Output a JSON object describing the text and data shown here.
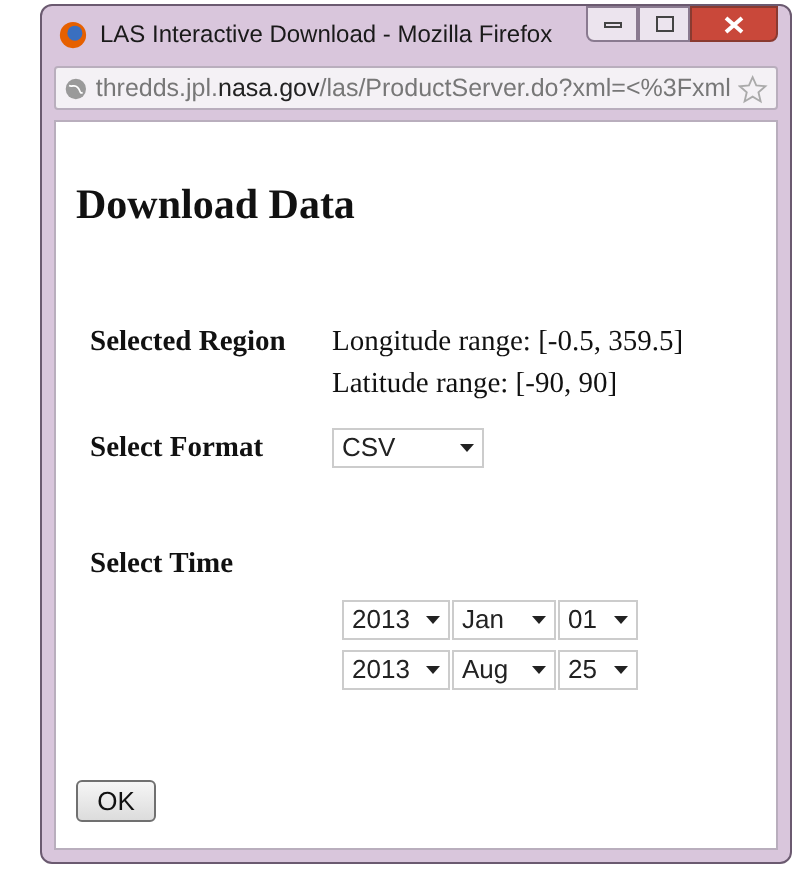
{
  "window": {
    "title": "LAS Interactive Download - Mozilla Firefox"
  },
  "address_bar": {
    "url": "thredds.jpl.**nasa.gov**/las/ProductServer.do?xml=<%3Fxml"
  },
  "heading": "Download Data",
  "region": {
    "label": "Selected Region",
    "lines": [
      "Longitude range: [-0.5, 359.5]",
      "Latitude range: [-90, 90]"
    ]
  },
  "format": {
    "label": "Select Format",
    "value": "CSV"
  },
  "time": {
    "label": "Select Time",
    "rows": [
      [
        "2013",
        "Jan",
        "01"
      ],
      [
        "2013",
        "Aug",
        "25"
      ]
    ]
  },
  "buttons": [
    "OK"
  ]
}
